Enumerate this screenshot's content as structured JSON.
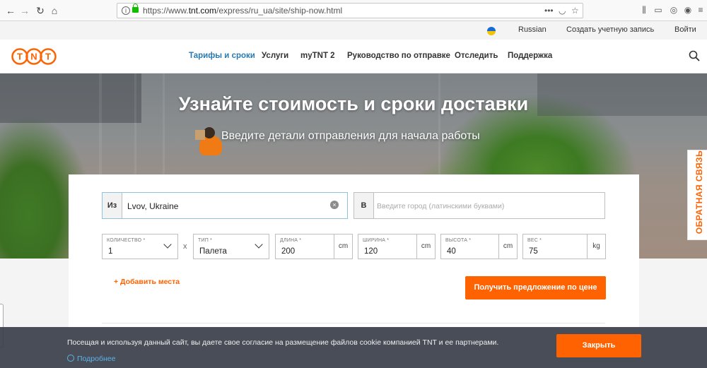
{
  "browser": {
    "url_prefix": "https://www.",
    "url_host": "tnt.com",
    "url_path": "/express/ru_ua/site/ship-now.html",
    "url_more": "•••"
  },
  "util_bar": {
    "language": "Russian",
    "create_account": "Создать учетную запись",
    "login": "Войти"
  },
  "nav": {
    "logo_text": "TNT",
    "items": [
      {
        "label": "Тарифы и сроки",
        "active": true
      },
      {
        "label": "Услуги"
      },
      {
        "label": "myTNT 2"
      },
      {
        "label": "Руководство по отправке"
      },
      {
        "label": "Отследить"
      },
      {
        "label": "Поддержка"
      }
    ]
  },
  "hero": {
    "title": "Узнайте стоимость и сроки доставки",
    "subtitle": "Введите детали отправления для начала работы"
  },
  "feedback": {
    "label": "ОБРАТНАЯ СВЯЗЬ"
  },
  "form": {
    "from": {
      "prefix": "Из",
      "value": "Lvov, Ukraine"
    },
    "to": {
      "prefix": "В",
      "placeholder": "Введите город (латинскими буквами)"
    },
    "quantity": {
      "label": "КОЛИЧЕСТВО *",
      "value": "1"
    },
    "times": "x",
    "type": {
      "label": "ТИП *",
      "value": "Палета"
    },
    "length": {
      "label": "ДЛИНА *",
      "value": "200",
      "unit": "cm"
    },
    "width": {
      "label": "ШИРИНА *",
      "value": "120",
      "unit": "cm"
    },
    "height": {
      "label": "ВЫСОТА *",
      "value": "40",
      "unit": "cm"
    },
    "weight": {
      "label": "ВЕС *",
      "value": "75",
      "unit": "kg"
    },
    "add_place": "+ Добавить места",
    "quote_button": "Получить предложение по цене"
  },
  "cookie": {
    "text": "Посещая и используя данный сайт, вы даете свое согласие на размещение файлов cookie компанией TNT и ее партнерами.",
    "more": "Подробнее",
    "close": "Закрыть"
  },
  "colors": {
    "accent": "#ff6200",
    "link": "#2a7ab0"
  }
}
